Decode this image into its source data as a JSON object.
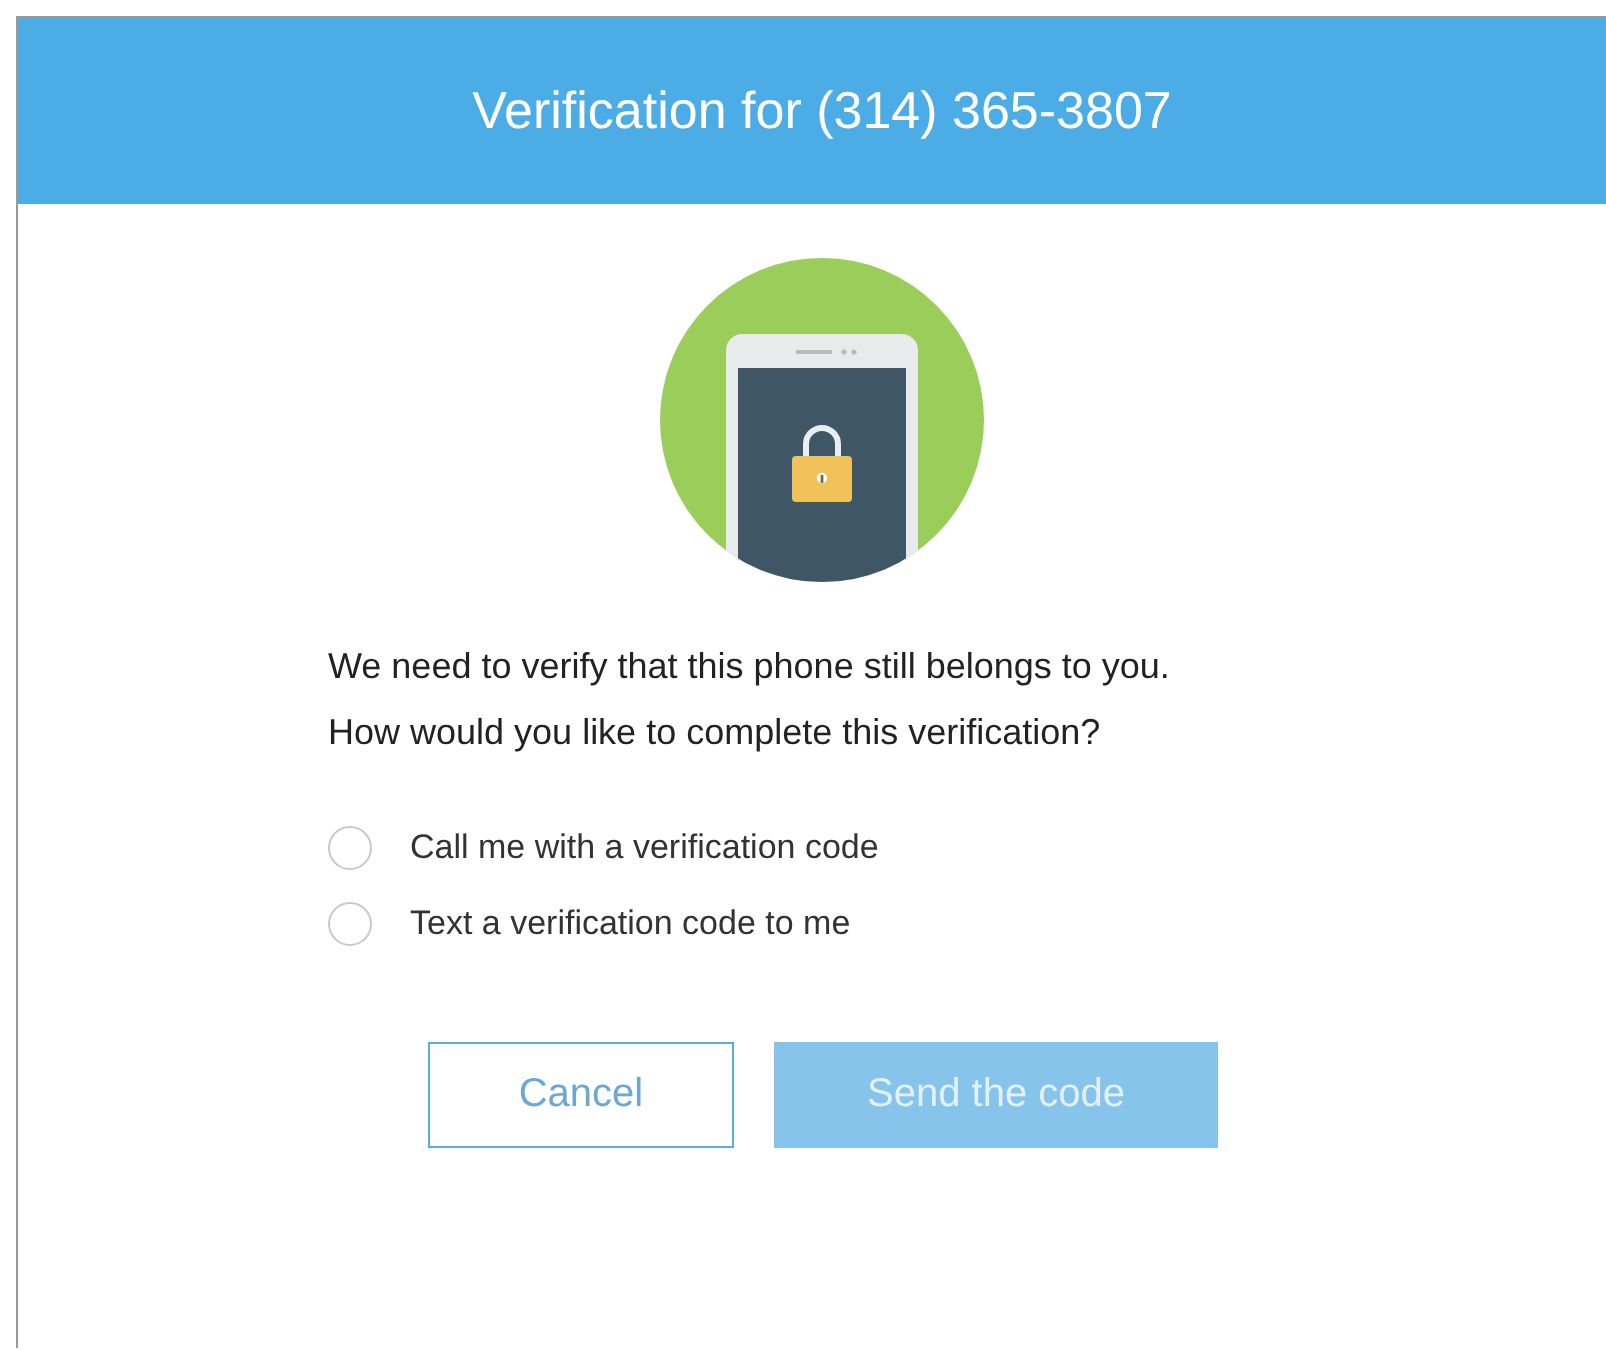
{
  "header": {
    "title": "Verification for (314) 365-3807"
  },
  "message": [
    "We need to verify that this phone still belongs to you.",
    "How would you like to complete this verification?"
  ],
  "options": [
    {
      "label": "Call me with a verification code",
      "selected": false
    },
    {
      "label": "Text a verification code to me",
      "selected": false
    }
  ],
  "buttons": [
    {
      "kind": "secondary",
      "label": "Cancel",
      "disabled": false
    },
    {
      "kind": "primary",
      "label": "Send the code",
      "disabled": true
    }
  ]
}
